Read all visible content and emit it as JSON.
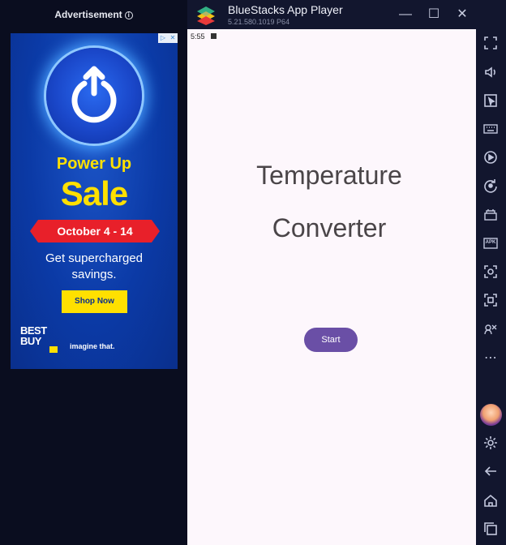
{
  "ad": {
    "header_label": "Advertisement",
    "info_symbol": "i",
    "adchoices_left": "▷",
    "adchoices_right": "✕",
    "headline_1": "Power Up",
    "headline_2": "Sale",
    "date_range": "October 4 - 14",
    "copy_line1": "Get supercharged",
    "copy_line2": "savings.",
    "cta_label": "Shop Now",
    "brand_line1": "BEST",
    "brand_line2": "BUY",
    "slogan": "imagine that.",
    "colors": {
      "background": "#0b3aa6",
      "accent_yellow": "#ffe000",
      "ribbon_red": "#e8202a"
    }
  },
  "window": {
    "title": "BlueStacks App Player",
    "version": "5.21.580.1019  P64",
    "controls": {
      "minimize": "—",
      "maximize": "☐",
      "close": "✕",
      "collapse": "«"
    }
  },
  "android": {
    "status_time": "5:55",
    "app": {
      "title_line1": "Temperature",
      "title_line2": "Converter",
      "start_button_label": "Start",
      "colors": {
        "background": "#fdf7fc",
        "button": "#6a4fa6",
        "text": "#4a4548"
      }
    }
  },
  "sidebar": {
    "icons": [
      "fullscreen-icon",
      "volume-icon",
      "pointer-icon",
      "keyboard-icon",
      "macro-icon",
      "rotate-icon",
      "multi-instance-icon",
      "apk-icon",
      "screenshot-icon",
      "screen-record-icon",
      "eco-mode-icon",
      "more-icon",
      "avatar",
      "settings-icon",
      "back-icon",
      "home-icon",
      "recents-icon"
    ],
    "apk_label": "APK",
    "more_symbol": "⋯"
  }
}
